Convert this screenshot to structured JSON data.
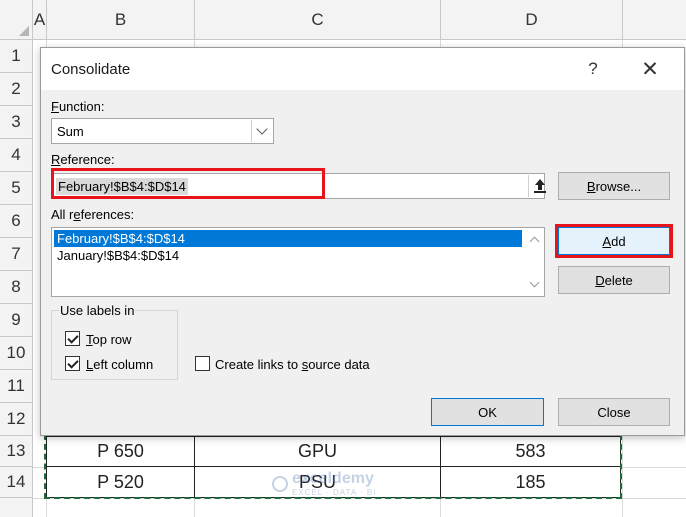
{
  "sheet": {
    "columns": [
      "A",
      "B",
      "C",
      "D"
    ],
    "rows": [
      "1",
      "2",
      "3",
      "4",
      "5",
      "6",
      "7",
      "8",
      "9",
      "10",
      "11",
      "12",
      "13",
      "14"
    ],
    "visible_cells": [
      [
        "P 650",
        "GPU",
        "583"
      ],
      [
        "P 520",
        "PSU",
        "185"
      ]
    ],
    "watermark": {
      "name": "exceldemy",
      "tagline": "EXCEL · DATA · BI"
    }
  },
  "dialog": {
    "title": "Consolidate",
    "help_symbol": "?",
    "close_symbol": "✕",
    "function": {
      "label_key": "F",
      "label_rest": "unction:",
      "value": "Sum"
    },
    "reference": {
      "label_key": "R",
      "label_rest": "eference:",
      "value": "February!$B$4:$D$14"
    },
    "browse_button": {
      "label_key": "B",
      "label_rest": "rowse..."
    },
    "all_references": {
      "label_pre": "All r",
      "label_key": "e",
      "label_rest": "ferences:",
      "items": [
        "February!$B$4:$D$14",
        "January!$B$4:$D$14"
      ],
      "selected_index": 0
    },
    "add_button": {
      "label_key": "A",
      "label_rest": "dd"
    },
    "delete_button": {
      "label_key": "D",
      "label_rest": "elete"
    },
    "use_labels": {
      "title": "Use labels in",
      "top_row": {
        "label_key": "T",
        "label_rest": "op row",
        "checked": true
      },
      "left_column": {
        "label_key": "L",
        "label_rest": "eft column",
        "checked": true
      }
    },
    "create_links": {
      "label_pre": "Create links to ",
      "label_key": "s",
      "label_rest": "ource data",
      "checked": false
    },
    "ok_button": "OK",
    "close_button": "Close"
  },
  "annotation_color": "#e8141c",
  "selection_color": "#0078d7"
}
